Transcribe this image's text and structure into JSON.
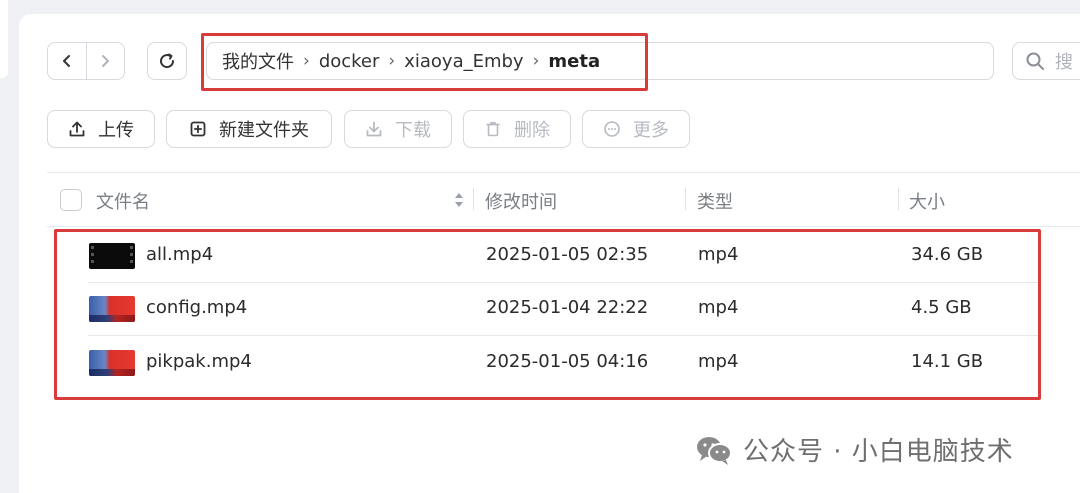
{
  "breadcrumb": {
    "items": [
      "我的文件",
      "docker",
      "xiaoya_Emby"
    ],
    "current": "meta"
  },
  "search": {
    "placeholder": "搜"
  },
  "toolbar": {
    "upload_label": "上传",
    "new_folder_label": "新建文件夹",
    "download_label": "下载",
    "delete_label": "删除",
    "more_label": "更多"
  },
  "table": {
    "columns": [
      "文件名",
      "修改时间",
      "类型",
      "大小"
    ],
    "rows": [
      {
        "name": "all.mp4",
        "modified": "2025-01-05 02:35",
        "type": "mp4",
        "size": "34.6 GB",
        "thumb": "dark"
      },
      {
        "name": "config.mp4",
        "modified": "2025-01-04 22:22",
        "type": "mp4",
        "size": "4.5 GB",
        "thumb": "pic"
      },
      {
        "name": "pikpak.mp4",
        "modified": "2025-01-05 04:16",
        "type": "mp4",
        "size": "14.1 GB",
        "thumb": "pic"
      }
    ]
  },
  "watermark": {
    "text": "公众号 · 小白电脑技术"
  },
  "colors": {
    "highlight": "#d93a3a",
    "border": "#d6d9de",
    "muted": "#7a7f86"
  }
}
